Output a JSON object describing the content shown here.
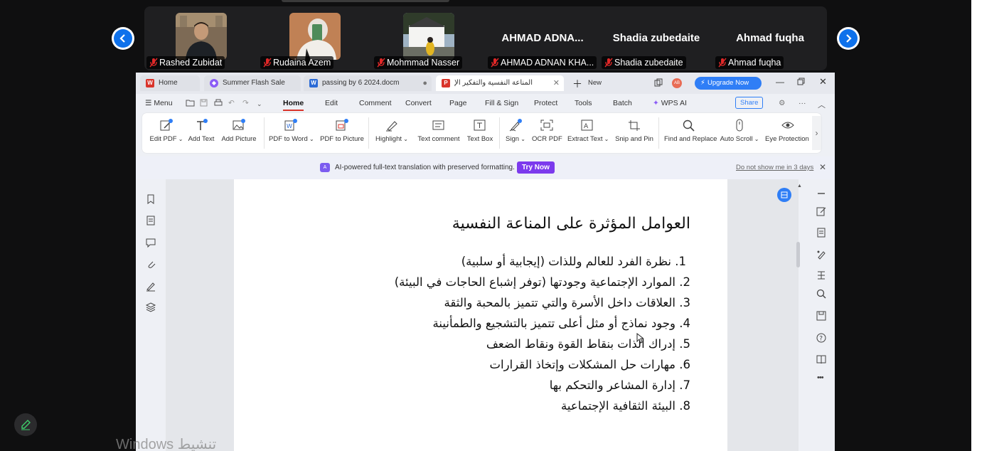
{
  "participants": [
    {
      "name": "Rashed Zubidat",
      "has_photo": true,
      "muted": true
    },
    {
      "name": "Rudaina  Azem",
      "has_photo": true,
      "muted": true
    },
    {
      "name": "Mohmmad Nasser",
      "has_photo": true,
      "muted": true
    },
    {
      "display": "AHMAD  ADNA...",
      "name": "AHMAD ADNAN KHA...",
      "has_photo": false,
      "muted": true
    },
    {
      "display": "Shadia zubedaite",
      "name": "Shadia zubedaite",
      "has_photo": false,
      "muted": true
    },
    {
      "display": "Ahmad fuqha",
      "name": "Ahmad fuqha",
      "has_photo": false,
      "muted": true
    }
  ],
  "wps": {
    "tabs": [
      {
        "label": "Home",
        "icon": "wps-logo-icon",
        "color": "#d9342b"
      },
      {
        "label": "Summer Flash Sale",
        "icon": "diamond-icon",
        "color": "#8b5cf6"
      },
      {
        "label": "passing by 6 2024.docm",
        "icon": "word-doc-icon",
        "color": "#2b6bd6"
      },
      {
        "label": "المناعة النفسية والتفكير الإيجابي",
        "icon": "pdf-icon",
        "color": "#d9342b"
      }
    ],
    "new_tab": "New",
    "avatar": "AB",
    "upgrade": "Upgrade Now",
    "menu": "Menu",
    "menu_tabs": [
      "Home",
      "Edit",
      "Comment",
      "Convert",
      "Page",
      "Fill & Sign",
      "Protect",
      "Tools",
      "Batch"
    ],
    "wps_ai": "WPS AI",
    "share": "Share",
    "ribbon": [
      "Edit PDF",
      "Add Text",
      "Add Picture",
      "PDF to Word",
      "PDF to Picture",
      "Highlight",
      "Text comment",
      "Text Box",
      "Sign",
      "OCR PDF",
      "Extract Text",
      "Snip and Pin",
      "Find and Replace",
      "Auto Scroll",
      "Eye Protection M"
    ],
    "notice": {
      "text": "AI-powered full-text translation with preserved formatting.",
      "button": "Try Now",
      "dismiss": "Do not show me in 3 days"
    },
    "accent": "#d9342b"
  },
  "document": {
    "title": "العوامل المؤثرة على المناعة النفسية",
    "items": [
      "1. نظرة الفرد للعالم وللذات (إيجابية أو سلبية)",
      "2. الموارد الإجتماعية وجودتها (توفر إشباع الحاجات في البيئة)",
      "3. العلاقات داخل الأسرة والتي تتميز بالمحبة والثقة",
      "4. وجود نماذج  أو مثل أعلى تتميز بالتشجيع والطمأنينة",
      "5. إدراك الذات بنقاط القوة ونقاط الضعف",
      "6. مهارات حل المشكلات وإتخاذ القرارات",
      "7. إدارة المشاعر والتحكم بها",
      "8. البيئة الثقافية الإجتماعية"
    ]
  },
  "windows_watermark": "Windows تنشيط",
  "zoom_accent": "#0e71eb"
}
